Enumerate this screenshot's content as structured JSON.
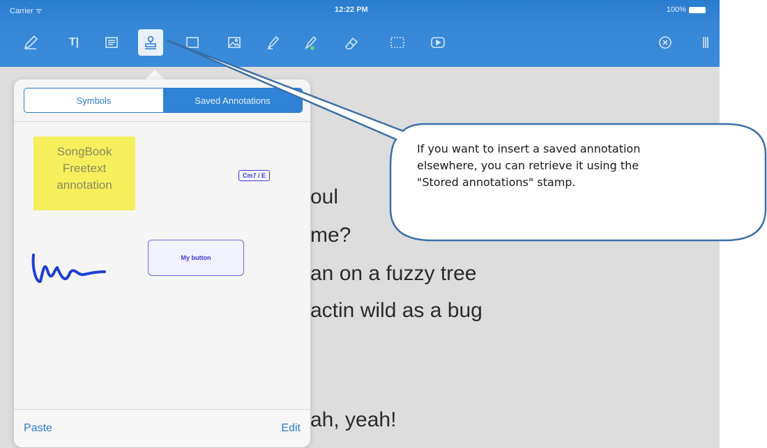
{
  "status": {
    "carrier": "Carrier ᯤ",
    "time": "12:22 PM",
    "battery": "100%"
  },
  "toolbar": {
    "icons": [
      "pen-icon",
      "text-icon",
      "note-icon",
      "stamp-icon",
      "rectangle-icon",
      "image-icon",
      "highlighter-icon",
      "marker-icon",
      "eraser-icon",
      "selection-icon",
      "media-icon",
      "close-icon",
      "tools-icon"
    ],
    "text_tool_label": "T|"
  },
  "popover": {
    "tabs": {
      "symbols": "Symbols",
      "saved": "Saved Annotations"
    },
    "note_lines": [
      "SongBook",
      "Freetext",
      "annotation"
    ],
    "chord_label": "Cm7 / E",
    "button_label": "My button",
    "paste_label": "Paste",
    "edit_label": "Edit"
  },
  "lyrics": [
    "oul",
    "me?",
    "an on a fuzzy tree",
    "actin wild as a bug",
    "ah, yeah!"
  ],
  "callout": {
    "line1": "If you want to insert a saved annotation",
    "line2": "elsewhere, you can retrieve it using the",
    "line3": "\"Stored annotations\" stamp."
  },
  "colors": {
    "toolbar": "#3787d8",
    "accent": "#2a7ccf",
    "note": "#f5ef5e",
    "ink": "#1f3fd0"
  }
}
